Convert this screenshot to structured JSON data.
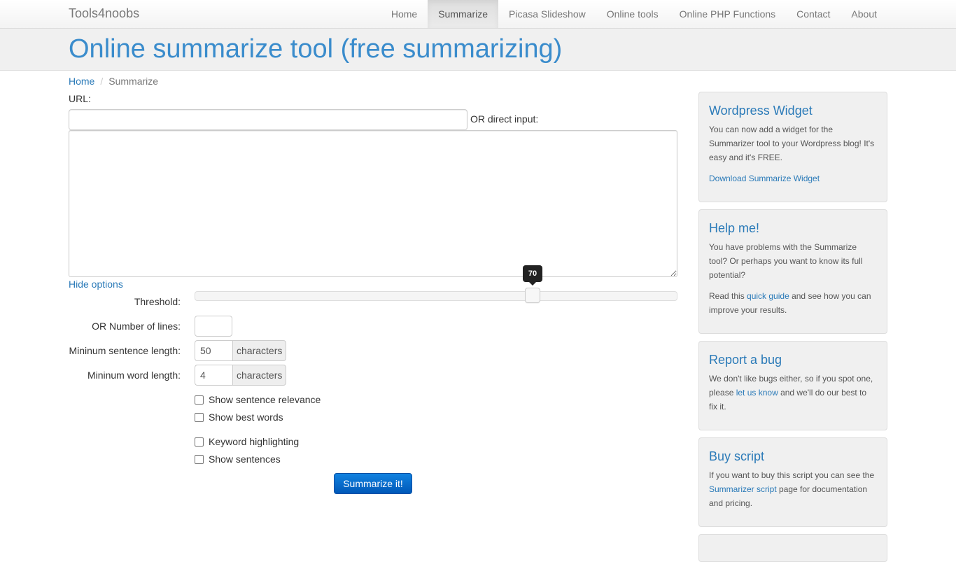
{
  "navbar": {
    "brand": "Tools4noobs",
    "items": [
      {
        "label": "Home",
        "active": false
      },
      {
        "label": "Summarize",
        "active": true
      },
      {
        "label": "Picasa Slideshow",
        "active": false
      },
      {
        "label": "Online tools",
        "active": false
      },
      {
        "label": "Online PHP Functions",
        "active": false
      },
      {
        "label": "Contact",
        "active": false
      },
      {
        "label": "About",
        "active": false
      }
    ]
  },
  "header": {
    "title": "Online summarize tool (free summarizing)"
  },
  "breadcrumb": {
    "home": "Home",
    "separator": "/",
    "current": "Summarize"
  },
  "form": {
    "url_label": "URL:",
    "url_value": "",
    "direct_input_label": "OR direct input:",
    "direct_input_value": "",
    "hide_options_link": "Hide options",
    "threshold_label": "Threshold:",
    "threshold_value": 70,
    "threshold_max": 100,
    "threshold_display": "70",
    "lines_label": "OR Number of lines:",
    "lines_value": "",
    "min_sentence_label": "Mininum sentence length:",
    "min_sentence_value": "50",
    "min_word_label": "Mininum word length:",
    "min_word_value": "4",
    "unit_label": "characters",
    "checkboxes": [
      {
        "label": "Show sentence relevance",
        "checked": false
      },
      {
        "label": "Show best words",
        "checked": false
      },
      {
        "label": "Keyword highlighting",
        "checked": false
      },
      {
        "label": "Show sentences",
        "checked": false
      }
    ],
    "submit_label": "Summarize it!"
  },
  "sidebar": {
    "wordpress": {
      "title": "Wordpress Widget",
      "text": "You can now add a widget for the Summarizer tool to your Wordpress blog! It's easy and it's FREE.",
      "link": "Download Summarize Widget"
    },
    "help": {
      "title": "Help me!",
      "text": "You have problems with the Summarize tool? Or perhaps you want to know its full potential?",
      "text2_before": "Read this ",
      "text2_link": "quick guide",
      "text2_after": " and see how you can improve your results."
    },
    "bug": {
      "title": "Report a bug",
      "text_before": "We don't like bugs either, so if you spot one, please ",
      "text_link": "let us know",
      "text_after": " and we'll do our best to fix it."
    },
    "buy": {
      "title": "Buy script",
      "text_before": "If you want to buy this script you can see the ",
      "text_link": "Summarizer script",
      "text_after": " page for documentation and pricing."
    }
  },
  "colors": {
    "accent": "#2a7ab8",
    "title": "#3a8ccc",
    "button": "#0a6fd0",
    "panel_bg": "#f0f0f0"
  }
}
